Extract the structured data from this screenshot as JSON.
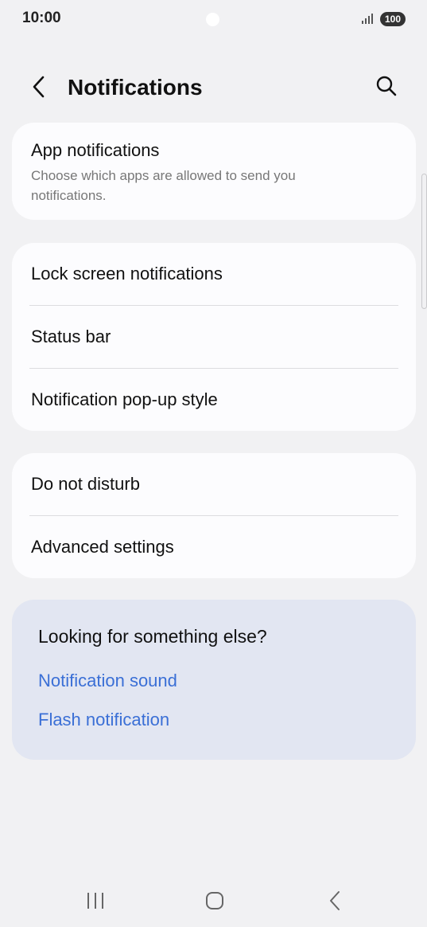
{
  "status_bar": {
    "time": "10:00",
    "battery": "100",
    "icons": [
      "signal-icon",
      "battery-icon",
      "camera-cutout"
    ]
  },
  "app_bar": {
    "title": "Notifications",
    "back_icon": "chevron-left-icon",
    "search_icon": "search-icon"
  },
  "app_notifications": {
    "title": "App notifications",
    "subtitle": "Choose which apps are allowed to send you notifications."
  },
  "group_one": [
    {
      "label": "Lock screen notifications"
    },
    {
      "label": "Status bar"
    },
    {
      "label": "Notification pop-up style"
    }
  ],
  "group_two": [
    {
      "label": "Do not disturb"
    },
    {
      "label": "Advanced settings"
    }
  ],
  "help": {
    "title": "Looking for something else?",
    "links": [
      "Notification sound",
      "Flash notification"
    ],
    "link_color": "#3a6fd6"
  },
  "nav_bar": {
    "icons": [
      "recent-apps-icon",
      "home-icon",
      "back-icon"
    ]
  },
  "colors": {
    "background": "#f1f1f3",
    "card": "#fcfcfe",
    "help_card": "#e2e6f2"
  }
}
